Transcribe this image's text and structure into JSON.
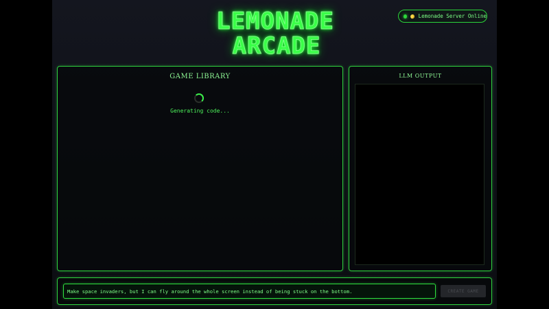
{
  "header": {
    "logo_line1": "LEMONADE",
    "logo_line2": "ARCADE"
  },
  "server_status": {
    "label": "Lemonade Server Online",
    "status_color": "#2dd63b",
    "icon": "lemon-icon"
  },
  "game_library": {
    "title": "GAME LIBRARY",
    "loading_text": "Generating code...",
    "loading_icon": "spinner"
  },
  "llm_output": {
    "title": "LLM OUTPUT",
    "content": ""
  },
  "prompt": {
    "value": "Make space invaders, but I can fly around the whole screen instead of being stuck on the bottom.",
    "create_label": "CREATE GAME"
  },
  "theme": {
    "accent": "#39ff47",
    "background": "#101219",
    "panel_border": "#2fd13e"
  }
}
